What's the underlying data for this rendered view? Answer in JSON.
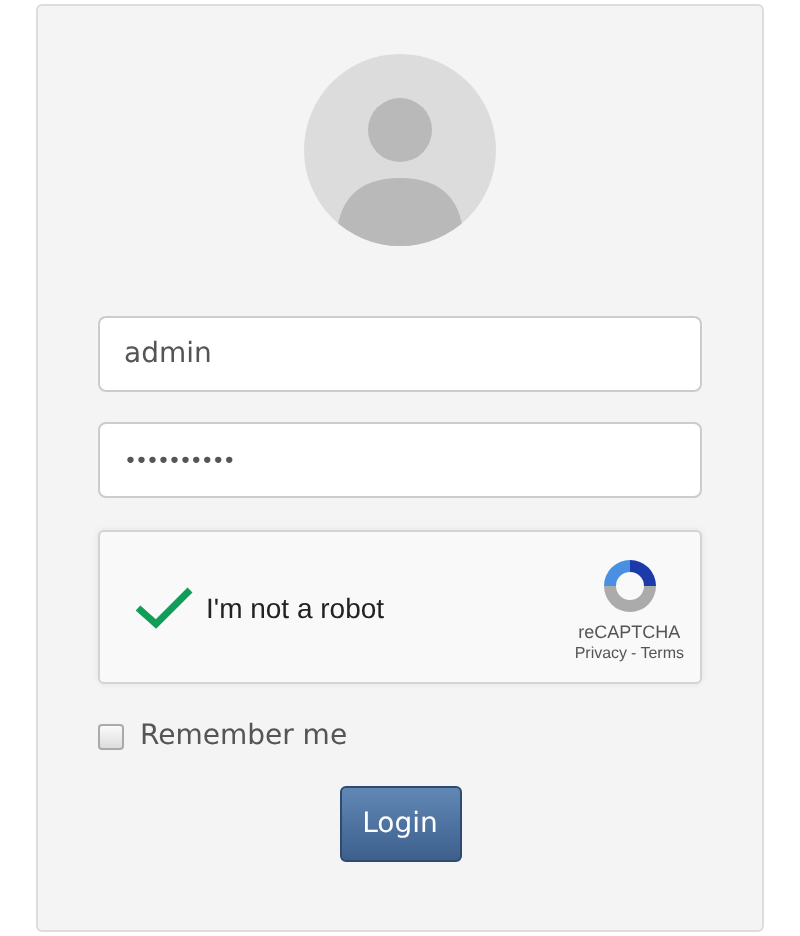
{
  "login_form": {
    "username": {
      "value": "admin"
    },
    "password": {
      "value": "••••••••••"
    },
    "captcha": {
      "checked": true,
      "label": "I'm not a robot",
      "brand": "reCAPTCHA",
      "privacy": "Privacy",
      "separator": "-",
      "terms": "Terms"
    },
    "remember_me": {
      "label": "Remember me",
      "checked": false
    },
    "button": "Login"
  }
}
